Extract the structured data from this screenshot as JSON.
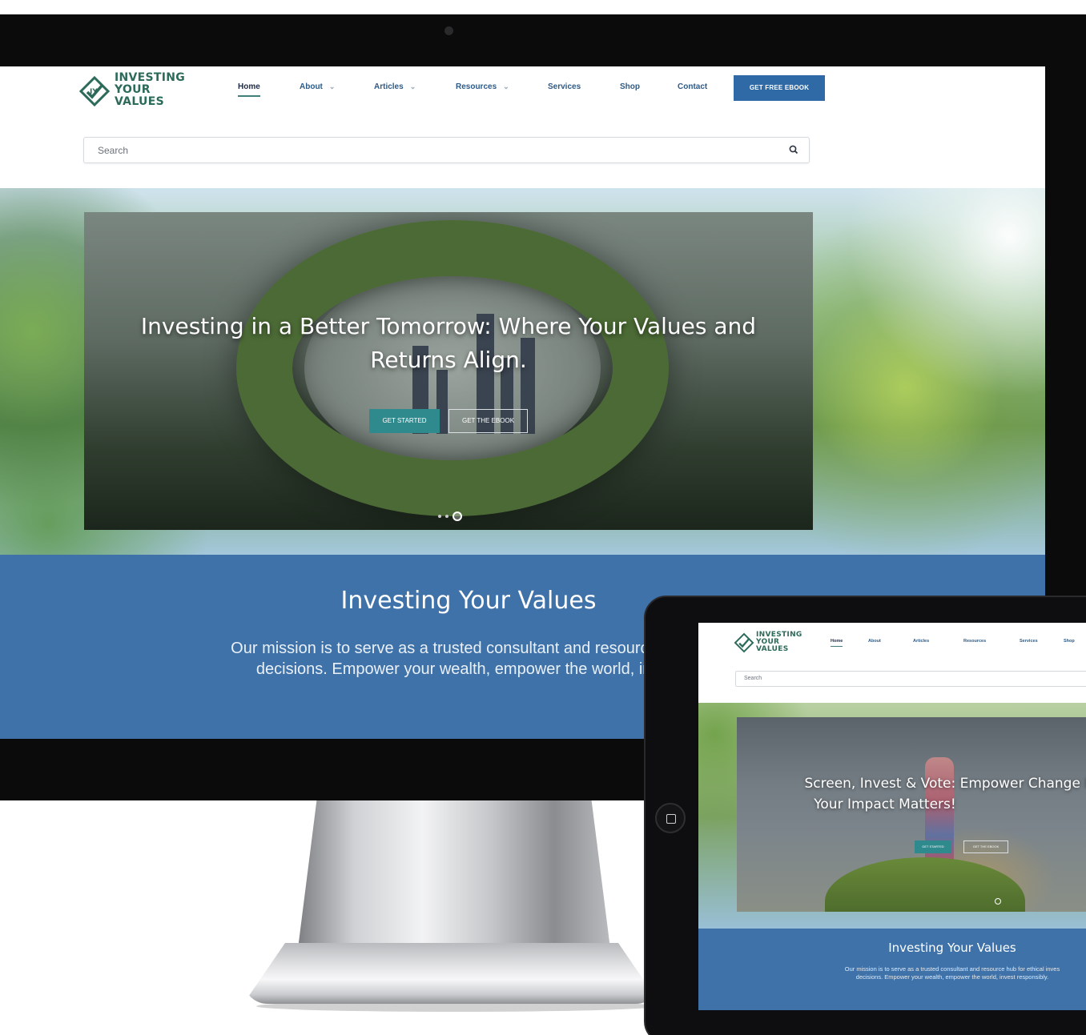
{
  "desktop": {
    "logo": {
      "line1": "INVESTING",
      "line2": "YOUR",
      "line3": "VALUES",
      "mark": "iyv-logo-icon"
    },
    "nav": {
      "items": [
        {
          "label": "Home",
          "has_caret": false,
          "active": true
        },
        {
          "label": "About",
          "has_caret": true
        },
        {
          "label": "Articles",
          "has_caret": true
        },
        {
          "label": "Resources",
          "has_caret": true
        },
        {
          "label": "Services",
          "has_caret": false
        },
        {
          "label": "Shop",
          "has_caret": false
        },
        {
          "label": "Contact",
          "has_caret": false
        }
      ],
      "cta": "GET FREE EBOOK"
    },
    "search": {
      "placeholder": "Search",
      "icon": "search-icon"
    },
    "hero": {
      "title_line1": "Investing in a Better Tomorrow: Where Your Values and",
      "title_line2": "Returns Align.",
      "primary_button": "GET STARTED",
      "secondary_button": "GET THE EBOOK",
      "slide_count": 3,
      "active_slide": 3
    },
    "mission": {
      "title": "Investing Your Values",
      "text_line1": "Our mission is to serve as a trusted consultant and resource hub fo",
      "text_line2": "decisions. Empower your wealth, empower the world, invest"
    }
  },
  "tablet": {
    "logo": {
      "line1": "INVESTING",
      "line2": "YOUR",
      "line3": "VALUES"
    },
    "nav": {
      "items": [
        {
          "label": "Home",
          "active": true
        },
        {
          "label": "About"
        },
        {
          "label": "Articles"
        },
        {
          "label": "Resources"
        },
        {
          "label": "Services"
        },
        {
          "label": "Shop"
        }
      ]
    },
    "search": {
      "placeholder": "Search"
    },
    "hero": {
      "title_line1": "Screen, Invest & Vote: Empower Change Resp",
      "title_line2": "Your Impact Matters!",
      "primary_button": "GET STARTED",
      "secondary_button": "GET THE EBOOK"
    },
    "mission": {
      "title": "Investing Your Values",
      "text_line1": "Our mission is to serve as a trusted consultant and resource hub for ethical inves",
      "text_line2": "decisions. Empower your wealth, empower the world, invest responsibly."
    }
  },
  "colors": {
    "brand_green": "#2c6a59",
    "nav_blue": "#2d5a86",
    "cta_blue": "#2f6aa6",
    "band_blue": "#3f72a8",
    "teal_button": "#2f8a8e"
  }
}
